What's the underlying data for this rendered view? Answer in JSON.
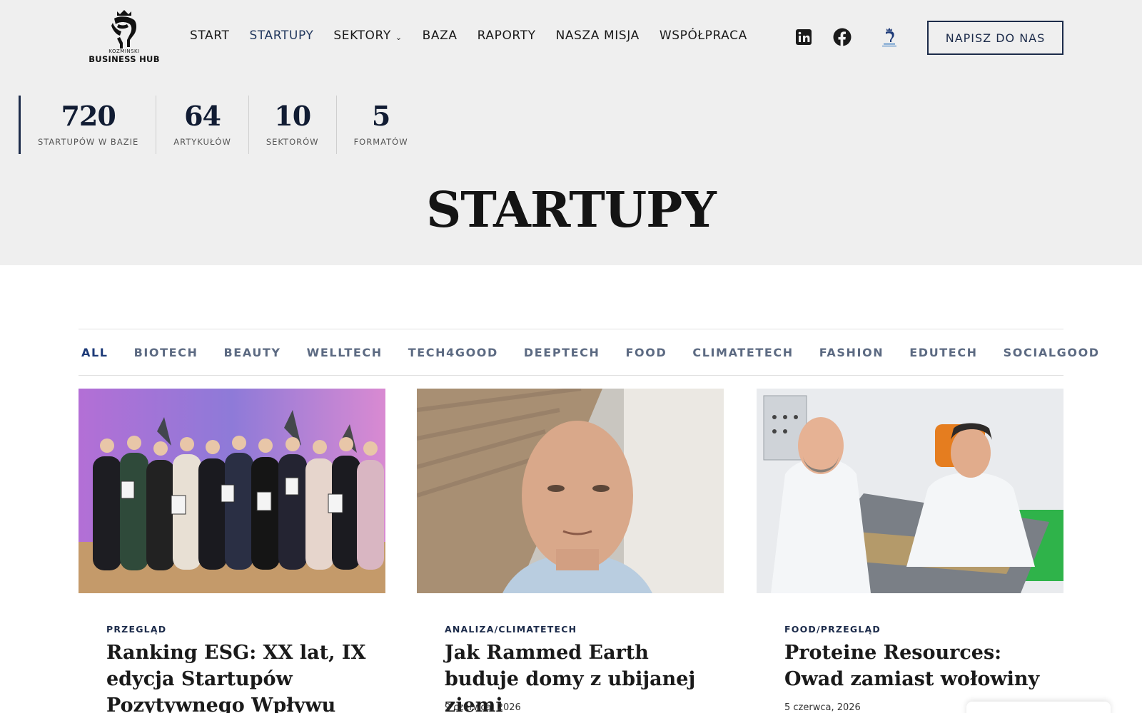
{
  "header": {
    "logo": {
      "small_text": "KOZMINSKI",
      "big_text": "BUSINESS HUB"
    },
    "nav": [
      {
        "label": "START",
        "active": false
      },
      {
        "label": "STARTUPY",
        "active": true
      },
      {
        "label": "SEKTORY",
        "active": false,
        "has_dropdown": true
      },
      {
        "label": "BAZA",
        "active": false
      },
      {
        "label": "RAPORTY",
        "active": false
      },
      {
        "label": "NASZA MISJA",
        "active": false
      },
      {
        "label": "WSPÓŁPRACA",
        "active": false
      }
    ],
    "social": [
      "linkedin-icon",
      "facebook-icon",
      "kozminski-logo-icon"
    ],
    "cta_label": "NAPISZ DO NAS"
  },
  "stats": [
    {
      "value": "720",
      "label": "STARTUPÓW W BAZIE"
    },
    {
      "value": "64",
      "label": "ARTYKUŁÓW"
    },
    {
      "value": "10",
      "label": "SEKTORÓW"
    },
    {
      "value": "5",
      "label": "FORMATÓW"
    }
  ],
  "page_title": "STARTUPY",
  "filters": [
    "ALL",
    "BIOTECH",
    "BEAUTY",
    "WELLTECH",
    "TECH4GOOD",
    "DEEPTECH",
    "FOOD",
    "CLIMATETECH",
    "FASHION",
    "EDUTECH",
    "SOCIALGOOD"
  ],
  "active_filter": "ALL",
  "cards": [
    {
      "category": "PRZEGLĄD",
      "title": "Ranking ESG: XX lat, IX edycja Startupów Pozytywnego Wpływu",
      "date": ""
    },
    {
      "category": "ANALIZA/CLIMATETECH",
      "title": "Jak Rammed Earth buduje domy z ubijanej ziemi",
      "date": "9 czerwca, 2026"
    },
    {
      "category": "FOOD/PRZEGLĄD",
      "title": "Proteine Resources: Owad zamiast wołowiny",
      "date": "5 czerwca, 2026"
    }
  ],
  "colors": {
    "navy": "#1c2b4a",
    "band_bg": "#efefef",
    "filter_active": "#1d3a78",
    "filter": "#5c6a82"
  }
}
